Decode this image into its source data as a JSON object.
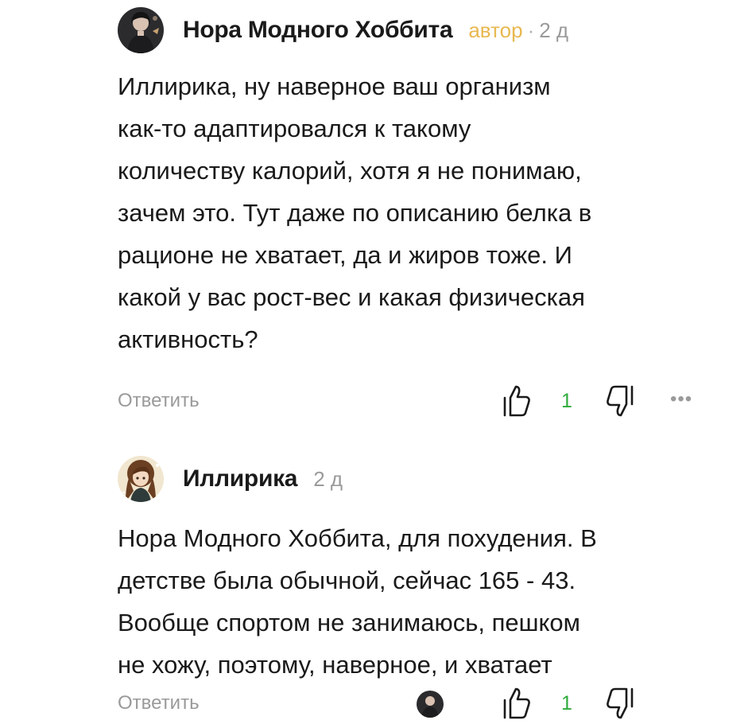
{
  "comments": [
    {
      "author": "Нора Модного Хоббита",
      "role": "автор",
      "separator": "·",
      "time": "2 д",
      "lines": [
        "Иллирика, ну наверное ваш организм",
        "как-то адаптировался к такому",
        "количеству калорий, хотя я не понимаю,",
        "зачем это. Тут даже по описанию белка в",
        "рационе не хватает, да и жиров тоже. И",
        "какой у вас рост-вес и какая физическая",
        "активность?"
      ],
      "reply_label": "Ответить",
      "likes": "1",
      "more": "•••"
    },
    {
      "author": "Иллирика",
      "time": "2 д",
      "lines": [
        "Нора Модного Хоббита, для похудения. В",
        "детстве была обычной, сейчас 165 - 43.",
        "Вообще спортом не занимаюсь, пешком",
        "не хожу, поэтому, наверное, и хватает"
      ],
      "reply_label": "Ответить",
      "likes": "1"
    }
  ],
  "icons": {
    "like": "thumbs-up-icon",
    "dislike": "thumbs-down-icon",
    "more": "more-options-icon"
  },
  "colors": {
    "text": "#1a1a1a",
    "muted": "#9a9a9a",
    "author_role": "#e8b850",
    "like_count": "#2faa3b"
  }
}
